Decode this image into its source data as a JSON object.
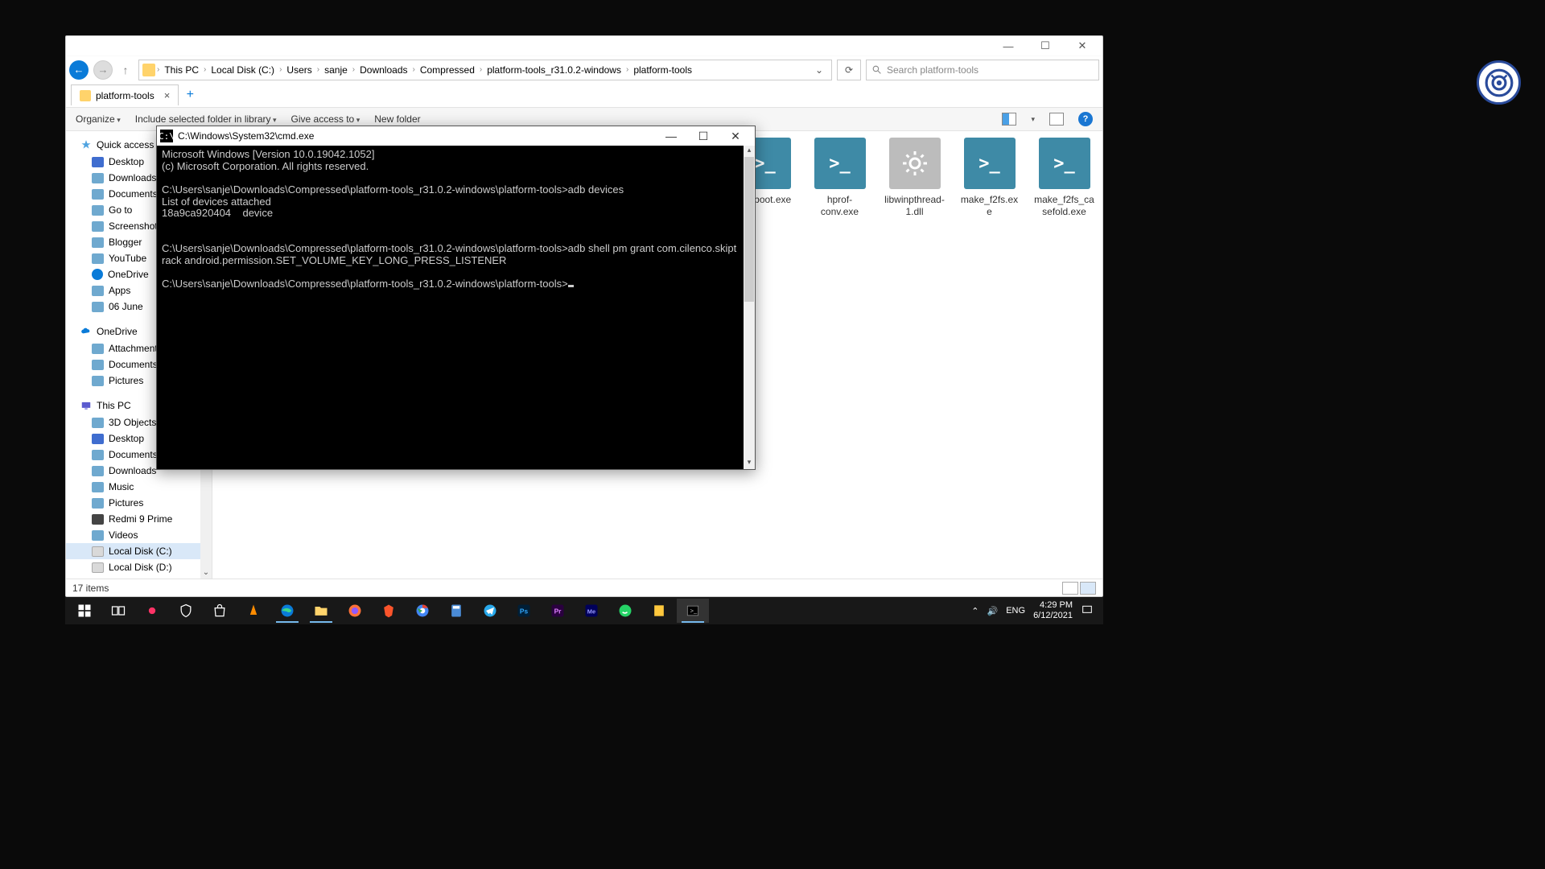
{
  "explorer": {
    "window_buttons": {
      "min": "—",
      "max": "☐",
      "close": "✕"
    },
    "breadcrumbs": [
      "This PC",
      "Local Disk (C:)",
      "Users",
      "sanje",
      "Downloads",
      "Compressed",
      "platform-tools_r31.0.2-windows",
      "platform-tools"
    ],
    "search_placeholder": "Search platform-tools",
    "tab_label": "platform-tools",
    "toolbar": {
      "organize": "Organize",
      "include": "Include selected folder in library",
      "give_access": "Give access to",
      "new_folder": "New folder"
    },
    "sidebar": {
      "quick_access": "Quick access",
      "qa_items": [
        "Desktop",
        "Downloads",
        "Documents",
        "Go to",
        "Screenshots",
        "Blogger",
        "YouTube",
        "OneDrive",
        "Apps",
        "06 June"
      ],
      "onedrive": "OneDrive",
      "od_items": [
        "Attachments",
        "Documents",
        "Pictures"
      ],
      "this_pc": "This PC",
      "pc_items": [
        "3D Objects",
        "Desktop",
        "Documents",
        "Downloads",
        "Music",
        "Pictures",
        "Redmi 9 Prime",
        "Videos",
        "Local Disk (C:)",
        "Local Disk (D:)"
      ]
    },
    "files": [
      {
        "name": "fastboot.exe",
        "type": "exe"
      },
      {
        "name": "hprof-conv.exe",
        "type": "exe"
      },
      {
        "name": "libwinpthread-1.dll",
        "type": "dll"
      },
      {
        "name": "make_f2fs.exe",
        "type": "exe"
      },
      {
        "name": "make_f2fs_casefold.exe",
        "type": "exe"
      }
    ],
    "status": "17 items"
  },
  "cmd": {
    "title": "C:\\Windows\\System32\\cmd.exe",
    "lines": "Microsoft Windows [Version 10.0.19042.1052]\n(c) Microsoft Corporation. All rights reserved.\n\nC:\\Users\\sanje\\Downloads\\Compressed\\platform-tools_r31.0.2-windows\\platform-tools>adb devices\nList of devices attached\n18a9ca920404    device\n\n\nC:\\Users\\sanje\\Downloads\\Compressed\\platform-tools_r31.0.2-windows\\platform-tools>adb shell pm grant com.cilenco.skiptrack android.permission.SET_VOLUME_KEY_LONG_PRESS_LISTENER\n\nC:\\Users\\sanje\\Downloads\\Compressed\\platform-tools_r31.0.2-windows\\platform-tools>"
  },
  "tray": {
    "lang": "ENG",
    "time": "4:29 PM",
    "date": "6/12/2021"
  }
}
